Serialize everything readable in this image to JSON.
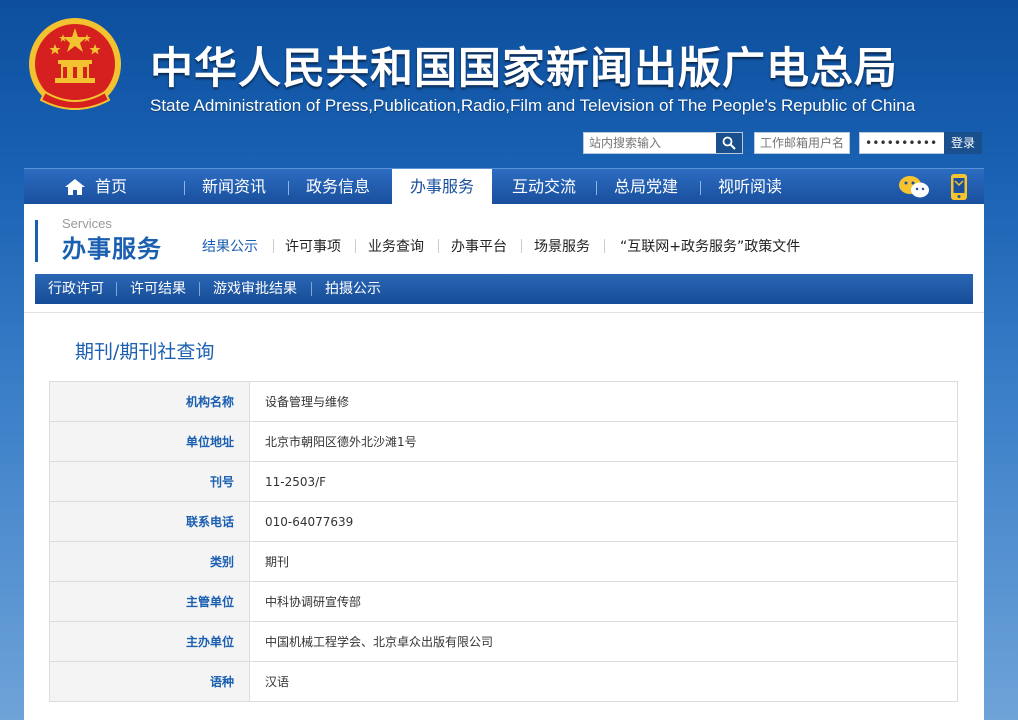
{
  "header": {
    "title": "中华人民共和国国家新闻出版广电总局",
    "subtitle": "State Administration of Press,Publication,Radio,Film and Television of The People's Republic of China",
    "search_placeholder": "站内搜索输入",
    "email_user_placeholder": "工作邮箱用户名",
    "email_password_value": "••••••••••",
    "login_label": "登录"
  },
  "nav": {
    "items": [
      {
        "label": "首页"
      },
      {
        "label": "新闻资讯"
      },
      {
        "label": "政务信息"
      },
      {
        "label": "办事服务"
      },
      {
        "label": "互动交流"
      },
      {
        "label": "总局党建"
      },
      {
        "label": "视听阅读"
      }
    ],
    "active_index": 3
  },
  "services": {
    "title_en": "Services",
    "title_zh": "办事服务",
    "subtabs": [
      {
        "label": "结果公示"
      },
      {
        "label": "许可事项"
      },
      {
        "label": "业务查询"
      },
      {
        "label": "办事平台"
      },
      {
        "label": "场景服务"
      },
      {
        "label": "“互联网+政务服务”政策文件"
      }
    ],
    "secondary_tabs": [
      {
        "label": "行政许可"
      },
      {
        "label": "许可结果"
      },
      {
        "label": "游戏审批结果"
      },
      {
        "label": "拍摄公示"
      }
    ]
  },
  "page": {
    "title": "期刊/期刊社查询",
    "rows": [
      {
        "label": "机构名称",
        "value": "设备管理与维修"
      },
      {
        "label": "单位地址",
        "value": "北京市朝阳区德外北沙滩1号"
      },
      {
        "label": "刊号",
        "value": "11-2503/F"
      },
      {
        "label": "联系电话",
        "value": "010-64077639"
      },
      {
        "label": "类别",
        "value": "期刊"
      },
      {
        "label": "主管单位",
        "value": "中科协调研宣传部"
      },
      {
        "label": "主办单位",
        "value": "中国机械工程学会、北京卓众出版有限公司"
      },
      {
        "label": "语种",
        "value": "汉语"
      }
    ]
  },
  "colors": {
    "brand_blue": "#1a4f9e",
    "link_blue": "#1a5fb0",
    "emblem_red": "#d61f1f",
    "emblem_gold": "#f2c230"
  }
}
